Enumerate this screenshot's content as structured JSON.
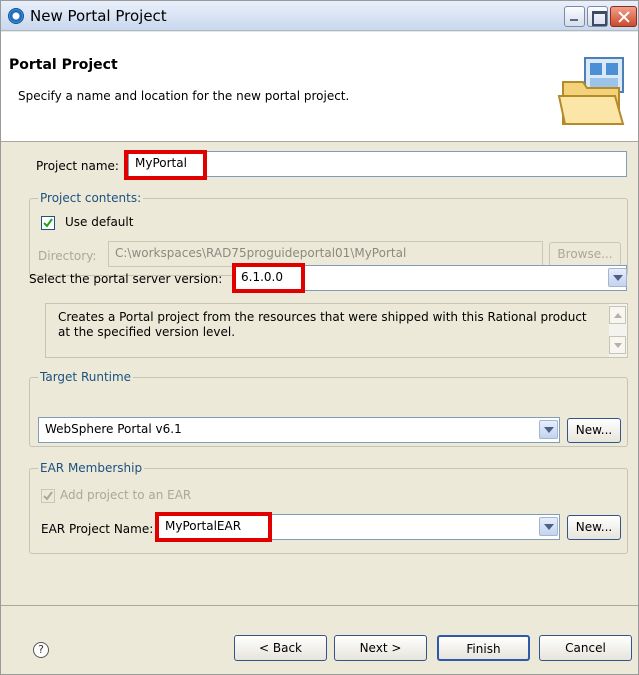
{
  "window": {
    "title": "New Portal Project"
  },
  "header": {
    "title": "Portal Project",
    "description": "Specify a name and location for the new portal project."
  },
  "project": {
    "name_label": "Project name:",
    "name_value": "MyPortal"
  },
  "contents": {
    "group_title": "Project contents:",
    "use_default_label": "Use default",
    "use_default_checked": true,
    "directory_label": "Directory:",
    "directory_value": "C:\\workspaces\\RAD75proguideportal01\\MyPortal",
    "browse_label": "Browse..."
  },
  "portal_version": {
    "label": "Select the portal server version:",
    "value": "6.1.0.0",
    "description": "Creates a Portal project from the resources that were shipped with this Rational product at the specified version level."
  },
  "target_runtime": {
    "group_title": "Target Runtime",
    "value": "WebSphere Portal v6.1",
    "new_label": "New..."
  },
  "ear": {
    "group_title": "EAR Membership",
    "add_label": "Add project to an EAR",
    "add_checked": true,
    "name_label": "EAR Project Name:",
    "name_value": "MyPortalEAR",
    "new_label": "New..."
  },
  "footer": {
    "help_symbol": "?",
    "back_label": "< Back",
    "next_label": "Next >",
    "finish_label": "Finish",
    "cancel_label": "Cancel"
  },
  "colors": {
    "highlight": "#e00000",
    "group_title": "#1c5180",
    "dialog_bg": "#ece9d8"
  }
}
